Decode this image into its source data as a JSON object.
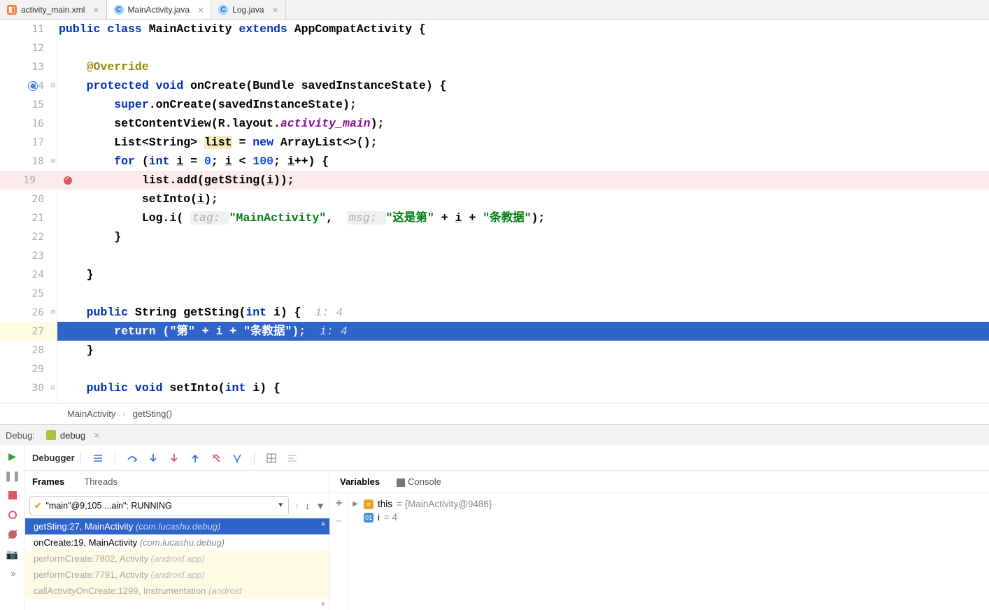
{
  "tabs": [
    {
      "label": "activity_main.xml",
      "icon": "xml",
      "active": false
    },
    {
      "label": "MainActivity.java",
      "icon": "java",
      "active": true
    },
    {
      "label": "Log.java",
      "icon": "java",
      "active": false
    }
  ],
  "editor": {
    "line_start": 11,
    "lines": [
      {
        "num": "11",
        "segs": [
          {
            "t": "kw",
            "v": "public class "
          },
          {
            "t": "",
            "v": "MainActivity "
          },
          {
            "t": "kw",
            "v": "extends "
          },
          {
            "t": "",
            "v": "AppCompatActivity {"
          }
        ]
      },
      {
        "num": "12",
        "segs": []
      },
      {
        "num": "13",
        "segs": [
          {
            "t": "",
            "v": "    "
          },
          {
            "t": "ann",
            "v": "@Override"
          }
        ]
      },
      {
        "num": "14",
        "segs": [
          {
            "t": "",
            "v": "    "
          },
          {
            "t": "kw",
            "v": "protected void "
          },
          {
            "t": "",
            "v": "onCreate(Bundle savedInstanceState) {"
          }
        ],
        "icon": "override"
      },
      {
        "num": "15",
        "segs": [
          {
            "t": "",
            "v": "        "
          },
          {
            "t": "kw",
            "v": "super"
          },
          {
            "t": "",
            "v": ".onCreate(savedInstanceState);"
          }
        ]
      },
      {
        "num": "16",
        "segs": [
          {
            "t": "",
            "v": "        setContentView(R.layout."
          },
          {
            "t": "field",
            "v": "activity_main"
          },
          {
            "t": "",
            "v": ");"
          }
        ]
      },
      {
        "num": "17",
        "segs": [
          {
            "t": "",
            "v": "        List<String> "
          },
          {
            "t": "hluse",
            "v": "list"
          },
          {
            "t": "",
            "v": " = "
          },
          {
            "t": "kw",
            "v": "new "
          },
          {
            "t": "",
            "v": "ArrayList<>();"
          }
        ]
      },
      {
        "num": "18",
        "segs": [
          {
            "t": "",
            "v": "        "
          },
          {
            "t": "kw",
            "v": "for "
          },
          {
            "t": "",
            "v": "("
          },
          {
            "t": "kw",
            "v": "int "
          },
          {
            "t": "u",
            "v": "i"
          },
          {
            "t": "",
            "v": " = "
          },
          {
            "t": "num",
            "v": "0"
          },
          {
            "t": "",
            "v": "; "
          },
          {
            "t": "u",
            "v": "i"
          },
          {
            "t": "",
            "v": " < "
          },
          {
            "t": "num",
            "v": "100"
          },
          {
            "t": "",
            "v": "; "
          },
          {
            "t": "u",
            "v": "i"
          },
          {
            "t": "",
            "v": "++) {"
          }
        ]
      },
      {
        "num": "19",
        "hl": true,
        "icon": "bp",
        "segs": [
          {
            "t": "",
            "v": "            list.add(getSting("
          },
          {
            "t": "u",
            "v": "i"
          },
          {
            "t": "",
            "v": "));"
          }
        ]
      },
      {
        "num": "20",
        "segs": [
          {
            "t": "",
            "v": "            setInto("
          },
          {
            "t": "u",
            "v": "i"
          },
          {
            "t": "",
            "v": ");"
          }
        ]
      },
      {
        "num": "21",
        "segs": [
          {
            "t": "",
            "v": "            Log.i( "
          },
          {
            "t": "hintbg",
            "v": "tag: "
          },
          {
            "t": "str",
            "v": "\"MainActivity\""
          },
          {
            "t": "",
            "v": ",  "
          },
          {
            "t": "hintbg",
            "v": "msg: "
          },
          {
            "t": "str",
            "v": "\"这是第\""
          },
          {
            "t": "",
            "v": " + "
          },
          {
            "t": "u",
            "v": "i"
          },
          {
            "t": "",
            "v": " + "
          },
          {
            "t": "str",
            "v": "\"条教据\""
          },
          {
            "t": "",
            "v": ");"
          }
        ]
      },
      {
        "num": "22",
        "segs": [
          {
            "t": "",
            "v": "        }"
          }
        ]
      },
      {
        "num": "23",
        "segs": []
      },
      {
        "num": "24",
        "segs": [
          {
            "t": "",
            "v": "    }"
          }
        ]
      },
      {
        "num": "25",
        "segs": []
      },
      {
        "num": "26",
        "segs": [
          {
            "t": "",
            "v": "    "
          },
          {
            "t": "kw",
            "v": "public "
          },
          {
            "t": "",
            "v": "String getSting("
          },
          {
            "t": "kw",
            "v": "int "
          },
          {
            "t": "",
            "v": "i) {  "
          },
          {
            "t": "hint",
            "v": "i: 4"
          }
        ]
      },
      {
        "num": "27",
        "exec": true,
        "segs": [
          {
            "t": "",
            "v": "        "
          },
          {
            "t": "",
            "v": "return ("
          },
          {
            "t": "",
            "v": "\"第\""
          },
          {
            "t": "",
            "v": " + i + "
          },
          {
            "t": "",
            "v": "\"条教据\""
          },
          {
            "t": "",
            "v": ");  "
          },
          {
            "t": "hint",
            "v": "i: 4"
          }
        ]
      },
      {
        "num": "28",
        "segs": [
          {
            "t": "",
            "v": "    }"
          }
        ]
      },
      {
        "num": "29",
        "segs": []
      },
      {
        "num": "30",
        "segs": [
          {
            "t": "",
            "v": "    "
          },
          {
            "t": "kw",
            "v": "public void "
          },
          {
            "t": "",
            "v": "setInto("
          },
          {
            "t": "kw",
            "v": "int "
          },
          {
            "t": "",
            "v": "i) {"
          }
        ]
      }
    ]
  },
  "breadcrumb": [
    "MainActivity",
    "getSting()"
  ],
  "debug": {
    "title": "Debug:",
    "config": "debug",
    "toolbar_tabs": {
      "debugger": "Debugger"
    },
    "panes": {
      "frames_tab": "Frames",
      "threads_tab": "Threads",
      "variables_tab": "Variables",
      "console_tab": "Console"
    },
    "thread": "\"main\"@9,105 ...ain\": RUNNING",
    "frames": [
      {
        "method": "getSting:27, MainActivity",
        "pkg": "(com.lucashu.debug)",
        "sel": true
      },
      {
        "method": "onCreate:19, MainActivity",
        "pkg": "(com.lucashu.debug)"
      },
      {
        "method": "performCreate:7802, Activity",
        "pkg": "(android.app)",
        "lib": true
      },
      {
        "method": "performCreate:7791, Activity",
        "pkg": "(android.app)",
        "lib": true
      },
      {
        "method": "callActivityOnCreate:1299, Instrumentation",
        "pkg": "(android",
        "lib": true,
        "cut": true
      }
    ],
    "vars": [
      {
        "icon": "obj",
        "name": "this",
        "val": "= {MainActivity@9486}",
        "expand": true
      },
      {
        "icon": "int",
        "name": "i",
        "val": "= 4"
      }
    ]
  }
}
